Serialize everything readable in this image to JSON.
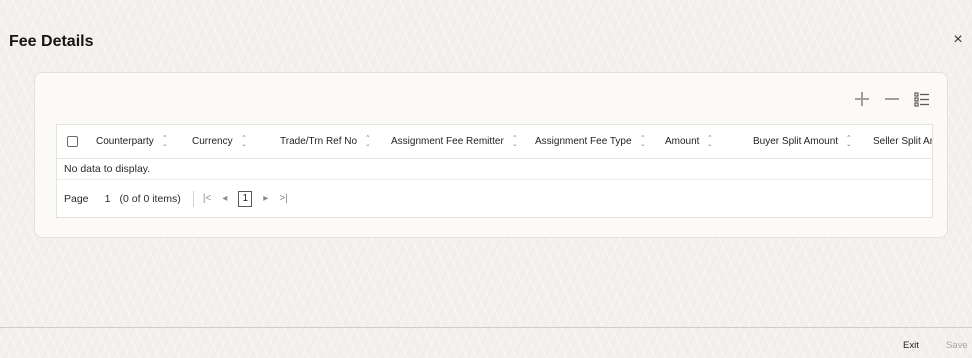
{
  "dialog": {
    "title": "Fee Details",
    "close_glyph": "×"
  },
  "toolbar": {
    "icons": [
      "plus-icon",
      "minus-icon",
      "column-list-icon"
    ]
  },
  "table": {
    "columns": [
      "Counterparty",
      "Currency",
      "Trade/Trn Ref No",
      "Assignment Fee Remitter",
      "Assignment Fee Type",
      "Amount",
      "Buyer Split Amount",
      "Seller Split Amo"
    ],
    "empty_message": "No data to display."
  },
  "pagination": {
    "page_label": "Page",
    "page_value": "1",
    "items_text": "(0 of 0 items)",
    "first_glyph": "|<",
    "prev_glyph": "◂",
    "current_page": "1",
    "next_glyph": "▸",
    "last_glyph": ">|"
  },
  "footer": {
    "exit_label": "Exit",
    "save_label": "Save"
  },
  "colors": {
    "background": "#f3f1ee",
    "panel": "#fbfaf8",
    "disabled_text": "#a9a6a2"
  }
}
